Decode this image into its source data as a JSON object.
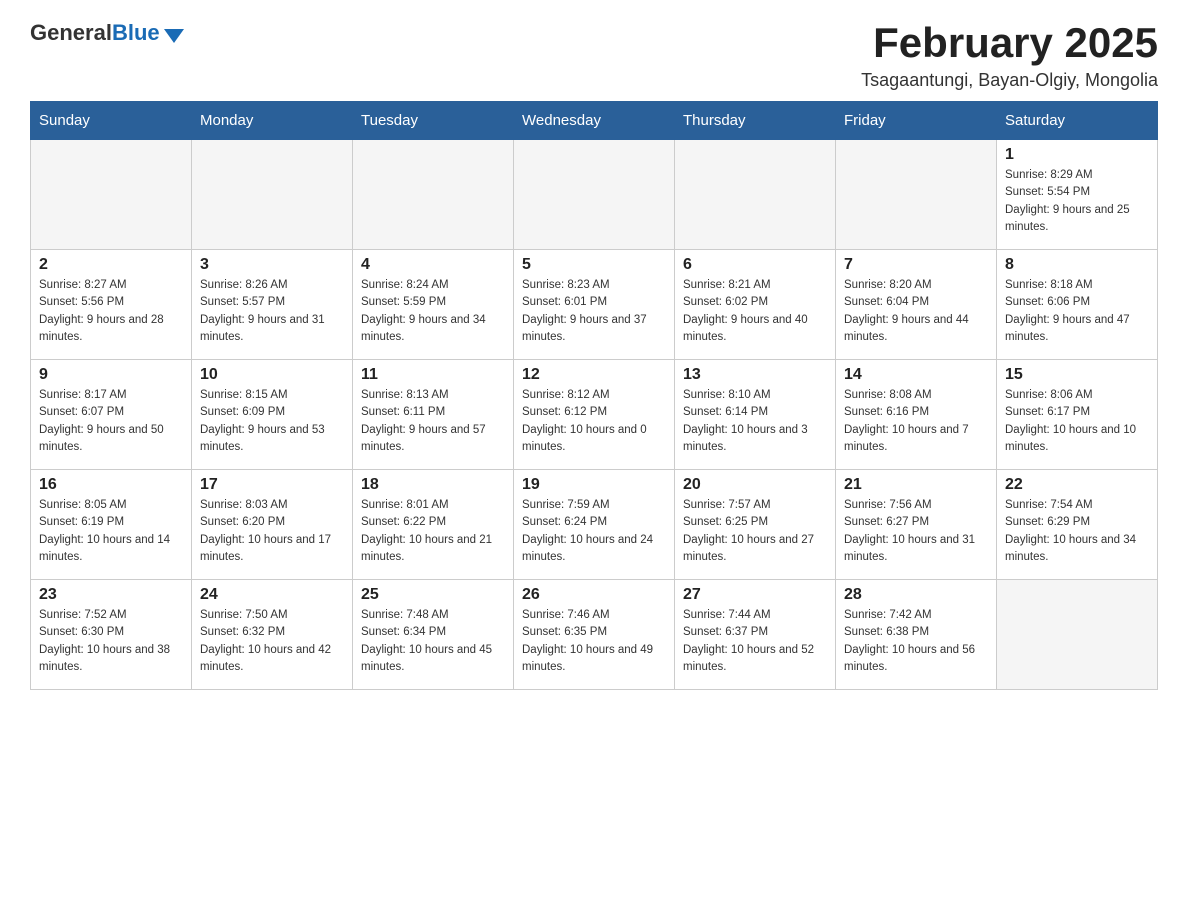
{
  "header": {
    "logo_general": "General",
    "logo_blue": "Blue",
    "month_year": "February 2025",
    "location": "Tsagaantungi, Bayan-Olgiy, Mongolia"
  },
  "weekdays": [
    "Sunday",
    "Monday",
    "Tuesday",
    "Wednesday",
    "Thursday",
    "Friday",
    "Saturday"
  ],
  "weeks": [
    [
      {
        "day": "",
        "sunrise": "",
        "sunset": "",
        "daylight": ""
      },
      {
        "day": "",
        "sunrise": "",
        "sunset": "",
        "daylight": ""
      },
      {
        "day": "",
        "sunrise": "",
        "sunset": "",
        "daylight": ""
      },
      {
        "day": "",
        "sunrise": "",
        "sunset": "",
        "daylight": ""
      },
      {
        "day": "",
        "sunrise": "",
        "sunset": "",
        "daylight": ""
      },
      {
        "day": "",
        "sunrise": "",
        "sunset": "",
        "daylight": ""
      },
      {
        "day": "1",
        "sunrise": "Sunrise: 8:29 AM",
        "sunset": "Sunset: 5:54 PM",
        "daylight": "Daylight: 9 hours and 25 minutes."
      }
    ],
    [
      {
        "day": "2",
        "sunrise": "Sunrise: 8:27 AM",
        "sunset": "Sunset: 5:56 PM",
        "daylight": "Daylight: 9 hours and 28 minutes."
      },
      {
        "day": "3",
        "sunrise": "Sunrise: 8:26 AM",
        "sunset": "Sunset: 5:57 PM",
        "daylight": "Daylight: 9 hours and 31 minutes."
      },
      {
        "day": "4",
        "sunrise": "Sunrise: 8:24 AM",
        "sunset": "Sunset: 5:59 PM",
        "daylight": "Daylight: 9 hours and 34 minutes."
      },
      {
        "day": "5",
        "sunrise": "Sunrise: 8:23 AM",
        "sunset": "Sunset: 6:01 PM",
        "daylight": "Daylight: 9 hours and 37 minutes."
      },
      {
        "day": "6",
        "sunrise": "Sunrise: 8:21 AM",
        "sunset": "Sunset: 6:02 PM",
        "daylight": "Daylight: 9 hours and 40 minutes."
      },
      {
        "day": "7",
        "sunrise": "Sunrise: 8:20 AM",
        "sunset": "Sunset: 6:04 PM",
        "daylight": "Daylight: 9 hours and 44 minutes."
      },
      {
        "day": "8",
        "sunrise": "Sunrise: 8:18 AM",
        "sunset": "Sunset: 6:06 PM",
        "daylight": "Daylight: 9 hours and 47 minutes."
      }
    ],
    [
      {
        "day": "9",
        "sunrise": "Sunrise: 8:17 AM",
        "sunset": "Sunset: 6:07 PM",
        "daylight": "Daylight: 9 hours and 50 minutes."
      },
      {
        "day": "10",
        "sunrise": "Sunrise: 8:15 AM",
        "sunset": "Sunset: 6:09 PM",
        "daylight": "Daylight: 9 hours and 53 minutes."
      },
      {
        "day": "11",
        "sunrise": "Sunrise: 8:13 AM",
        "sunset": "Sunset: 6:11 PM",
        "daylight": "Daylight: 9 hours and 57 minutes."
      },
      {
        "day": "12",
        "sunrise": "Sunrise: 8:12 AM",
        "sunset": "Sunset: 6:12 PM",
        "daylight": "Daylight: 10 hours and 0 minutes."
      },
      {
        "day": "13",
        "sunrise": "Sunrise: 8:10 AM",
        "sunset": "Sunset: 6:14 PM",
        "daylight": "Daylight: 10 hours and 3 minutes."
      },
      {
        "day": "14",
        "sunrise": "Sunrise: 8:08 AM",
        "sunset": "Sunset: 6:16 PM",
        "daylight": "Daylight: 10 hours and 7 minutes."
      },
      {
        "day": "15",
        "sunrise": "Sunrise: 8:06 AM",
        "sunset": "Sunset: 6:17 PM",
        "daylight": "Daylight: 10 hours and 10 minutes."
      }
    ],
    [
      {
        "day": "16",
        "sunrise": "Sunrise: 8:05 AM",
        "sunset": "Sunset: 6:19 PM",
        "daylight": "Daylight: 10 hours and 14 minutes."
      },
      {
        "day": "17",
        "sunrise": "Sunrise: 8:03 AM",
        "sunset": "Sunset: 6:20 PM",
        "daylight": "Daylight: 10 hours and 17 minutes."
      },
      {
        "day": "18",
        "sunrise": "Sunrise: 8:01 AM",
        "sunset": "Sunset: 6:22 PM",
        "daylight": "Daylight: 10 hours and 21 minutes."
      },
      {
        "day": "19",
        "sunrise": "Sunrise: 7:59 AM",
        "sunset": "Sunset: 6:24 PM",
        "daylight": "Daylight: 10 hours and 24 minutes."
      },
      {
        "day": "20",
        "sunrise": "Sunrise: 7:57 AM",
        "sunset": "Sunset: 6:25 PM",
        "daylight": "Daylight: 10 hours and 27 minutes."
      },
      {
        "day": "21",
        "sunrise": "Sunrise: 7:56 AM",
        "sunset": "Sunset: 6:27 PM",
        "daylight": "Daylight: 10 hours and 31 minutes."
      },
      {
        "day": "22",
        "sunrise": "Sunrise: 7:54 AM",
        "sunset": "Sunset: 6:29 PM",
        "daylight": "Daylight: 10 hours and 34 minutes."
      }
    ],
    [
      {
        "day": "23",
        "sunrise": "Sunrise: 7:52 AM",
        "sunset": "Sunset: 6:30 PM",
        "daylight": "Daylight: 10 hours and 38 minutes."
      },
      {
        "day": "24",
        "sunrise": "Sunrise: 7:50 AM",
        "sunset": "Sunset: 6:32 PM",
        "daylight": "Daylight: 10 hours and 42 minutes."
      },
      {
        "day": "25",
        "sunrise": "Sunrise: 7:48 AM",
        "sunset": "Sunset: 6:34 PM",
        "daylight": "Daylight: 10 hours and 45 minutes."
      },
      {
        "day": "26",
        "sunrise": "Sunrise: 7:46 AM",
        "sunset": "Sunset: 6:35 PM",
        "daylight": "Daylight: 10 hours and 49 minutes."
      },
      {
        "day": "27",
        "sunrise": "Sunrise: 7:44 AM",
        "sunset": "Sunset: 6:37 PM",
        "daylight": "Daylight: 10 hours and 52 minutes."
      },
      {
        "day": "28",
        "sunrise": "Sunrise: 7:42 AM",
        "sunset": "Sunset: 6:38 PM",
        "daylight": "Daylight: 10 hours and 56 minutes."
      },
      {
        "day": "",
        "sunrise": "",
        "sunset": "",
        "daylight": ""
      }
    ]
  ]
}
